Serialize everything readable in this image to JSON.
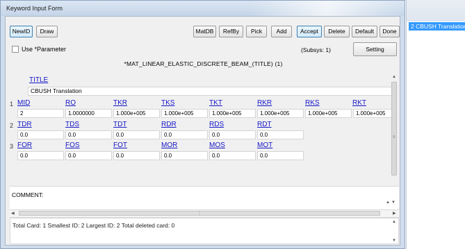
{
  "window": {
    "title": "Keyword Input Form"
  },
  "toolbar": {
    "newid": "NewID",
    "draw": "Draw",
    "matdb": "MatDB",
    "refby": "RefBy",
    "pick": "Pick",
    "add": "Add",
    "accept": "Accept",
    "delete": "Delete",
    "default": "Default",
    "done": "Done"
  },
  "options": {
    "use_parameter": "Use *Parameter",
    "subsys": "(Subsys: 1)",
    "setting": "Setting"
  },
  "keyword": {
    "title": "*MAT_LINEAR_ELASTIC_DISCRETE_BEAM_(TITLE)   (1)"
  },
  "title_card": {
    "label": "TITLE",
    "value": "CBUSH Translation"
  },
  "card1": {
    "num": "1",
    "labels": [
      "MID",
      "RO",
      "TKR",
      "TKS",
      "TKT",
      "RKR",
      "RKS",
      "RKT"
    ],
    "values": [
      "2",
      "1.0000000",
      "1.000e+005",
      "1.000e+005",
      "1.000e+005",
      "1.000e+005",
      "1.000e+005",
      "1.000e+005"
    ]
  },
  "card2": {
    "num": "2",
    "labels": [
      "TDR",
      "TDS",
      "TDT",
      "RDR",
      "RDS",
      "RDT"
    ],
    "values": [
      "0.0",
      "0.0",
      "0.0",
      "0.0",
      "0.0",
      "0.0"
    ]
  },
  "card3": {
    "num": "3",
    "labels": [
      "FOR",
      "FOS",
      "FOT",
      "MOR",
      "MOS",
      "MOT"
    ],
    "values": [
      "0.0",
      "0.0",
      "0.0",
      "0.0",
      "0.0",
      "0.0"
    ]
  },
  "comment": {
    "label": "COMMENT:"
  },
  "status": {
    "text": "Total Card: 1   Smallest ID: 2   Largest ID: 2   Total deleted card:  0"
  },
  "side_list": {
    "item": "2   CBUSH Translation"
  }
}
